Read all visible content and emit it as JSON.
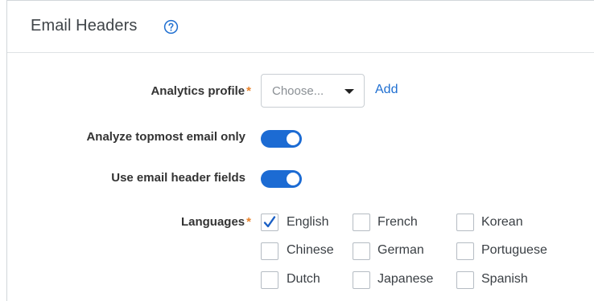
{
  "header": {
    "title": "Email Headers",
    "help_icon": "help-circle-icon"
  },
  "colors": {
    "accent": "#1c6bd3",
    "link": "#1f6fd1",
    "required": "#e8822a"
  },
  "form": {
    "analytics_profile": {
      "label": "Analytics profile",
      "required_mark": "*",
      "value": "Choose...",
      "add_label": "Add"
    },
    "analyze_topmost": {
      "label": "Analyze topmost email only",
      "enabled": true
    },
    "use_header_fields": {
      "label": "Use email header fields",
      "enabled": true
    },
    "languages": {
      "label": "Languages",
      "required_mark": "*",
      "options": [
        {
          "label": "English",
          "checked": true
        },
        {
          "label": "French",
          "checked": false
        },
        {
          "label": "Korean",
          "checked": false
        },
        {
          "label": "Chinese",
          "checked": false
        },
        {
          "label": "German",
          "checked": false
        },
        {
          "label": "Portuguese",
          "checked": false
        },
        {
          "label": "Dutch",
          "checked": false
        },
        {
          "label": "Japanese",
          "checked": false
        },
        {
          "label": "Spanish",
          "checked": false
        }
      ]
    }
  }
}
